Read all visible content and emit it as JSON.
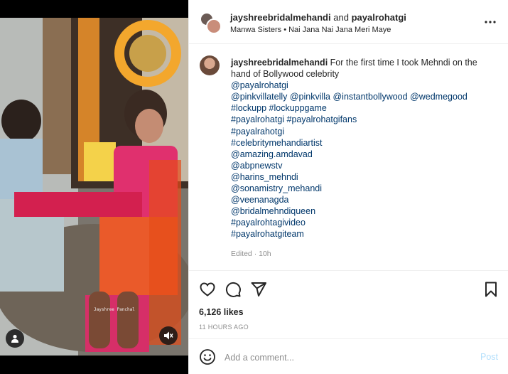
{
  "header": {
    "author": "jayshreebridalmehandi",
    "connector": "and",
    "coauthor": "payalrohatgi",
    "audio": "Manwa Sisters • Nai Jana Nai Jana Meri Maye"
  },
  "caption": {
    "author": "jayshreebridalmehandi",
    "text": "For the first time I took Mehndi on the hand of Bollywood celebrity",
    "tag_lines": [
      "@payalrohatgi",
      "@pinkvillatelly @pinkvilla @instantbollywood @wedmegood",
      "#lockupp #lockuppgame",
      "#payalrohatgi #payalrohatgifans",
      "#payalrahotgi",
      "#celebritymehandiartist",
      "@amazing.amdavad",
      "@abpnewstv",
      "@harins_mehndi",
      "@sonamistry_mehandi",
      "@veenanagda",
      "@bridalmehndiqueen",
      "#payalrohtagivideo",
      "#payalrohatgiteam"
    ],
    "edited": "Edited · 10h"
  },
  "stats": {
    "likes": "6,126 likes",
    "time": "11 HOURS AGO"
  },
  "comment": {
    "placeholder": "Add a comment...",
    "post_label": "Post"
  },
  "media": {
    "watermark": "Jayshree Panchal"
  },
  "icons": {
    "more": "more-horizontal-icon",
    "like": "heart-icon",
    "comment": "comment-icon",
    "share": "send-icon",
    "save": "bookmark-icon",
    "emoji": "emoji-icon",
    "user_tag": "user-icon",
    "mute": "speaker-muted-icon"
  },
  "colors": {
    "link": "#00376b",
    "muted": "#8e8e8e",
    "post_disabled": "#b2dffc"
  }
}
